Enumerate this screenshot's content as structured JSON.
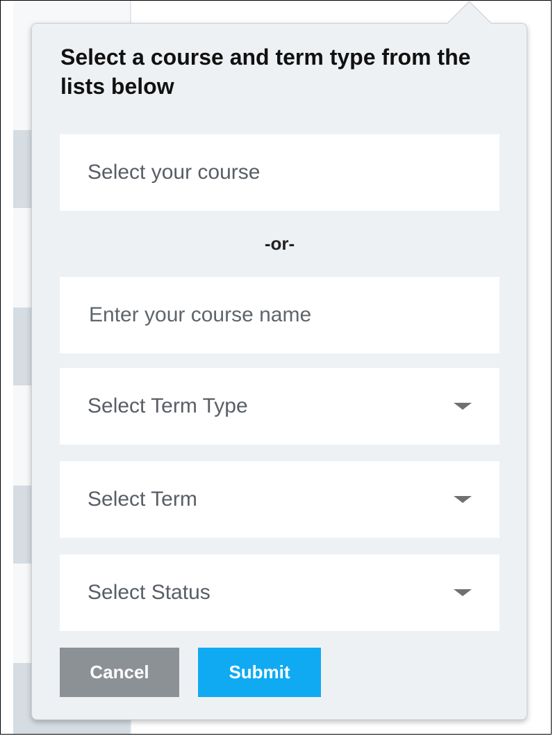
{
  "popover": {
    "title": "Select a course and term type from the lists below",
    "course_select_placeholder": "Select your course",
    "or_separator": "-or-",
    "course_name_placeholder": "Enter your course name",
    "term_type_label": "Select Term Type",
    "term_label": "Select Term",
    "status_label": "Select Status",
    "cancel_label": "Cancel",
    "submit_label": "Submit"
  },
  "colors": {
    "panel_bg": "#eef1f4",
    "cancel_bg": "#8c9196",
    "submit_bg": "#10aaf2"
  },
  "icons": {
    "dropdown": "caret-down-icon"
  }
}
